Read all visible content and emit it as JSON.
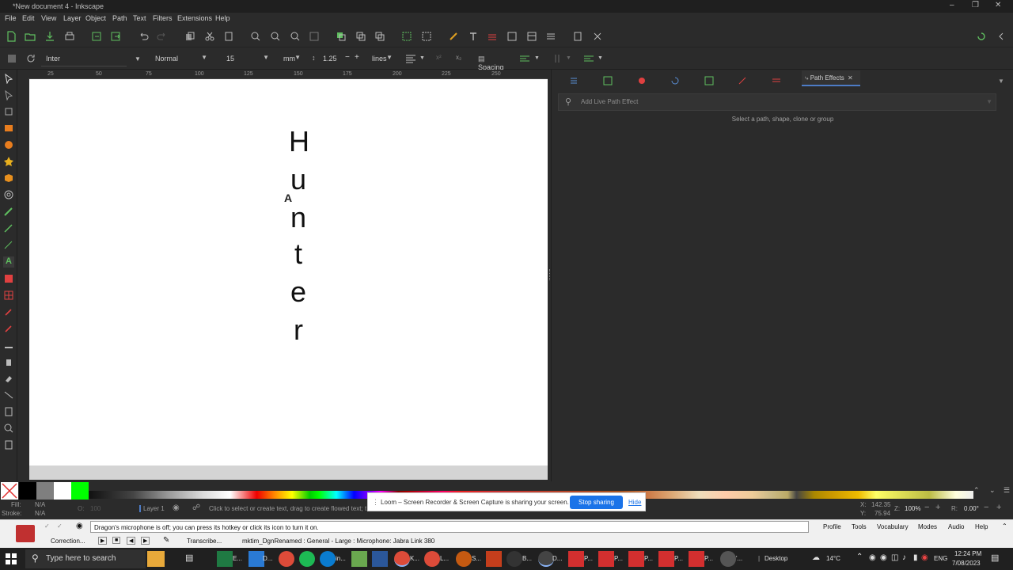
{
  "window": {
    "title": "*New document 4 - Inkscape"
  },
  "menu": [
    "File",
    "Edit",
    "View",
    "Layer",
    "Object",
    "Path",
    "Text",
    "Filters",
    "Extensions",
    "Help"
  ],
  "text_toolbar": {
    "font_family": "Inter",
    "font_style": "Normal",
    "font_size": "15",
    "unit": "mm",
    "line_height": "1.25",
    "line_unit": "lines",
    "spacing_label": "Spacing"
  },
  "ruler": [
    "25",
    "50",
    "75",
    "100",
    "125",
    "150",
    "175",
    "200",
    "225",
    "250"
  ],
  "canvas": {
    "letters": [
      "H",
      "u",
      "n",
      "t",
      "e",
      "r"
    ]
  },
  "panel": {
    "active_tab": "Path Effects",
    "search_placeholder": "Add Live Path Effect",
    "message": "Select a path, shape, clone or group"
  },
  "status": {
    "fill_label": "Fill:",
    "fill_value": "N/A",
    "stroke_label": "Stroke:",
    "stroke_value": "N/A",
    "opacity_label": "O:",
    "opacity_value": "100",
    "layer": "Layer 1",
    "hint": "Click to select or create text, drag to create flowed text; t",
    "x_label": "X:",
    "x_value": "142.35",
    "y_label": "Y:",
    "y_value": "75.94",
    "zoom_label": "Z:",
    "zoom_value": "100%",
    "rotation_label": "R:",
    "rotation_value": "0.00°"
  },
  "loom": {
    "message": "Loom – Screen Recorder & Screen Capture is sharing your screen.",
    "stop_button": "Stop sharing",
    "hide_link": "Hide"
  },
  "dragon": {
    "message": "Dragon's microphone is off; you can press its hotkey or click its icon to turn it on.",
    "menu": [
      "Profile",
      "Tools",
      "Vocabulary",
      "Modes",
      "Audio",
      "Help"
    ],
    "correction": "Correction...",
    "transcribe": "Transcribe...",
    "profile_info": "mktim_DgnRenamed : General - Large : Microphone: Jabra Link 380"
  },
  "taskbar": {
    "search_placeholder": "Type here to search",
    "apps": [
      "E...",
      "D...",
      "in...",
      "K...",
      "L...",
      "S...",
      "P...",
      "B...",
      "D...",
      "P...",
      "P...",
      "P...",
      "P...",
      "P...",
      "P...",
      "'..."
    ],
    "desktop_label": "Desktop",
    "weather": "14°C",
    "language": "ENG",
    "time": "12:24 PM",
    "date": "7/08/2023"
  },
  "colors": {
    "accent": "#4d7cc6",
    "loom_button": "#1a73e8",
    "swatch_green": "#00ff00"
  }
}
